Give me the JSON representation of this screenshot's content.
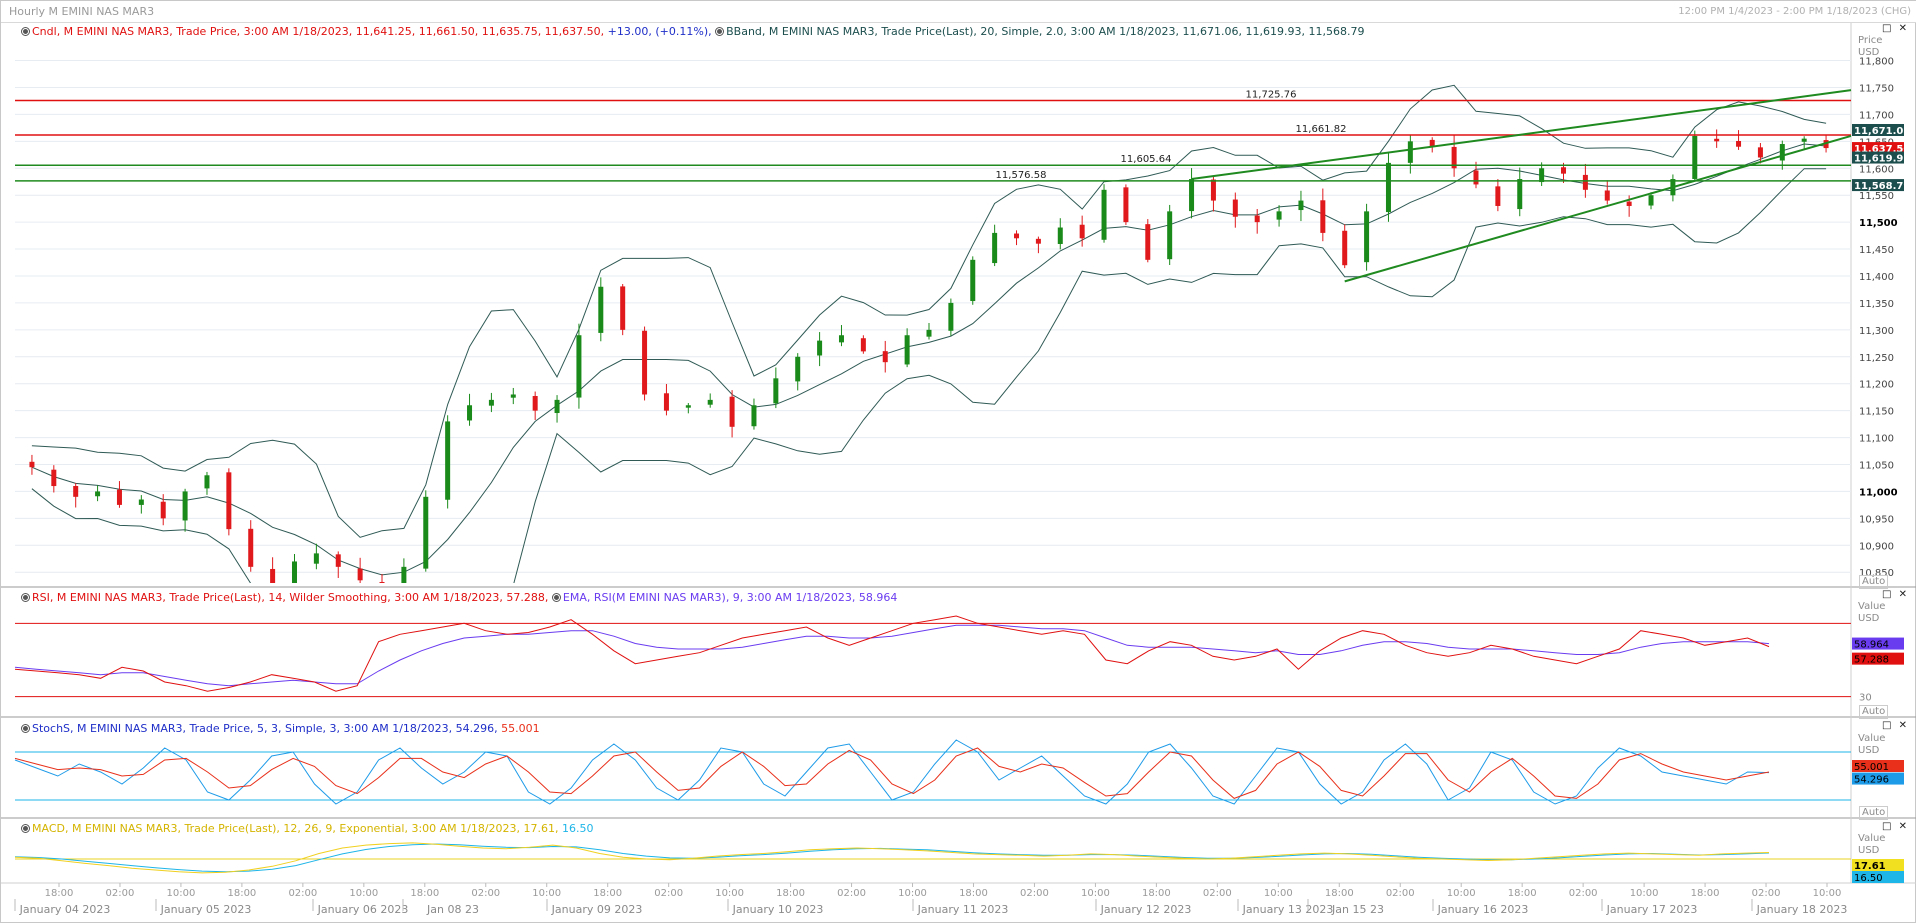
{
  "window": {
    "title": "Hourly M EMINI NAS MAR3",
    "range_text": "12:00 PM 1/4/2023 - 2:00 PM 1/18/2023 (CHG)",
    "controls": "□ ✕"
  },
  "legends": {
    "price_cndl": {
      "label": "Cndl, M EMINI NAS MAR3, Trade Price,  3:00 AM 1/18/2023, 11,641.25, 11,661.50, 11,635.75, 11,637.50,",
      "change": " +13.00,  (+0.11%),"
    },
    "price_bband": "BBand, M EMINI NAS MAR3, Trade Price(Last),  20, Simple, 2.0,  3:00 AM 1/18/2023, 11,671.06, 11,619.93, 11,568.79",
    "rsi": "RSI, M EMINI NAS MAR3, Trade Price(Last),  14, Wilder Smoothing,  3:00 AM 1/18/2023, 57.288,",
    "rsi_ema": "EMA, RSI(M EMINI NAS MAR3),  9,  3:00 AM 1/18/2023, 58.964",
    "stoch": "StochS, M EMINI NAS MAR3, Trade Price,  5, 3, Simple, 3,  3:00 AM 1/18/2023, 54.296,",
    "stoch_d": " 55.001",
    "macd": "MACD, M EMINI NAS MAR3, Trade Price(Last),  12, 26, 9, Exponential,  3:00 AM 1/18/2023, 17.61,",
    "macd_signal": " 16.50"
  },
  "axes": {
    "price_title_1": "Price",
    "price_title_2": "USD",
    "value_title": "Value",
    "value_unit": "USD",
    "auto_label": "Auto"
  },
  "colors": {
    "up": "#1a8a1a",
    "down": "#e0191c",
    "bband": "#2f5a55",
    "hline_red": "#e01010",
    "hline_green": "#1f8a1f",
    "trend": "#1f8a1f",
    "rsi": "#e01010",
    "rsi_ema": "#6a3cf0",
    "stoch_k": "#1e9be8",
    "stoch_d": "#e8301a",
    "macd": "#f0d020",
    "macd_signal": "#1eb5e8",
    "grid": "#e6ecf2",
    "legend_blue": "#1f2f9a"
  },
  "chart_data": [
    {
      "type": "candlestick",
      "title": "Hourly M EMINI NAS MAR3",
      "ylabel": "Price USD",
      "ylim": [
        10830,
        11840
      ],
      "yticks": [
        10850,
        10900,
        10950,
        11000,
        11050,
        11100,
        11150,
        11200,
        11250,
        11300,
        11350,
        11400,
        11450,
        11500,
        11550,
        11600,
        11650,
        11700,
        11750,
        11800
      ],
      "bold_ticks": [
        11000,
        11500
      ],
      "x_time_labels": [
        "18:00",
        "02:00",
        "10:00",
        "18:00",
        "02:00",
        "10:00",
        "18:00",
        "02:00",
        "10:00",
        "18:00",
        "02:00",
        "10:00",
        "18:00",
        "02:00",
        "10:00",
        "18:00",
        "02:00",
        "10:00",
        "18:00",
        "02:00",
        "10:00",
        "18:00",
        "02:00",
        "10:00",
        "18:00",
        "02:00",
        "10:00",
        "18:00",
        "02:00",
        "10:00"
      ],
      "x_date_labels": [
        "January 04 2023",
        "January 05 2023",
        "January 06 2023",
        "Jan 08 23",
        "January 09 2023",
        "January 10 2023",
        "January 11 2023",
        "January 12 2023",
        "January 13 2023",
        "Jan 15 23",
        "January 16 2023",
        "January 17 2023",
        "January 18 2023"
      ],
      "close_path": [
        11045,
        11010,
        10990,
        11000,
        10975,
        10985,
        10950,
        11000,
        11030,
        10930,
        10860,
        10830,
        10870,
        10885,
        10860,
        10835,
        10790,
        10860,
        10990,
        11130,
        11160,
        11170,
        11180,
        11150,
        11170,
        11290,
        11380,
        11300,
        11180,
        11150,
        11160,
        11170,
        11120,
        11160,
        11210,
        11250,
        11280,
        11290,
        11260,
        11240,
        11290,
        11300,
        11350,
        11430,
        11480,
        11470,
        11460,
        11490,
        11470,
        11560,
        11500,
        11430,
        11520,
        11580,
        11540,
        11510,
        11500,
        11520,
        11540,
        11480,
        11420,
        11520,
        11610,
        11650,
        11640,
        11600,
        11570,
        11530,
        11580,
        11600,
        11590,
        11560,
        11540,
        11530,
        11550,
        11580,
        11660,
        11650,
        11640,
        11620,
        11645,
        11655,
        11637.5
      ],
      "current_price": 11637.5,
      "horizontal_lines": [
        {
          "value": 11725.76,
          "label": "11,725.76",
          "color": "red"
        },
        {
          "value": 11661.82,
          "label": "11,661.82",
          "color": "red"
        },
        {
          "value": 11605.64,
          "label": "11,605.64",
          "color": "green"
        },
        {
          "value": 11576.58,
          "label": "11,576.58",
          "color": "green"
        }
      ],
      "price_tags": [
        {
          "value": 11671.06,
          "label": "11,671.06",
          "bg": "#1d4e4e"
        },
        {
          "value": 11637.5,
          "label": "11,637.50",
          "bg": "#e01010"
        },
        {
          "value": 11619.93,
          "label": "11,619.93",
          "bg": "#1d4e4e"
        },
        {
          "value": 11568.79,
          "label": "11,568.79",
          "bg": "#1d4e4e"
        }
      ],
      "bollinger": {
        "period": 20,
        "stddev": 2.0,
        "upper_last": 11671.06,
        "middle_last": 11619.93,
        "lower_last": 11568.79
      }
    },
    {
      "type": "line",
      "title": "RSI",
      "ylim": [
        20,
        80
      ],
      "reference_lines": [
        70,
        30
      ],
      "tick_labels": [
        "30"
      ],
      "series": [
        {
          "name": "RSI",
          "values": [
            45,
            44,
            43,
            42,
            40,
            46,
            44,
            38,
            36,
            33,
            35,
            38,
            42,
            40,
            38,
            33,
            36,
            60,
            64,
            66,
            68,
            70,
            66,
            64,
            65,
            68,
            72,
            64,
            55,
            48,
            50,
            52,
            54,
            58,
            62,
            64,
            66,
            68,
            62,
            58,
            62,
            66,
            70,
            72,
            74,
            70,
            68,
            66,
            64,
            66,
            64,
            50,
            48,
            55,
            60,
            58,
            52,
            50,
            52,
            56,
            45,
            55,
            62,
            66,
            64,
            58,
            54,
            52,
            54,
            58,
            56,
            52,
            50,
            48,
            52,
            56,
            66,
            64,
            62,
            58,
            60,
            62,
            57.288
          ]
        },
        {
          "name": "EMA",
          "values": [
            46,
            45,
            44,
            43,
            42,
            43,
            43,
            41,
            39,
            37,
            36,
            37,
            38,
            39,
            38,
            37,
            37,
            44,
            50,
            55,
            59,
            62,
            63,
            64,
            64,
            65,
            66,
            66,
            63,
            59,
            57,
            56,
            56,
            56,
            57,
            59,
            61,
            63,
            63,
            62,
            62,
            63,
            65,
            67,
            69,
            69,
            69,
            68,
            67,
            67,
            66,
            62,
            58,
            57,
            57,
            57,
            56,
            55,
            54,
            55,
            53,
            53,
            55,
            58,
            60,
            60,
            59,
            57,
            56,
            56,
            56,
            55,
            54,
            53,
            53,
            54,
            57,
            59,
            60,
            60,
            60,
            60,
            58.964
          ]
        }
      ]
    },
    {
      "type": "line",
      "title": "StochS",
      "ylim": [
        0,
        100
      ],
      "reference_lines": [
        80,
        20
      ],
      "series": [
        {
          "name": "%K",
          "values": [
            70,
            60,
            50,
            65,
            55,
            40,
            60,
            85,
            70,
            30,
            20,
            45,
            75,
            80,
            40,
            15,
            30,
            70,
            85,
            60,
            40,
            55,
            80,
            75,
            30,
            15,
            35,
            70,
            90,
            70,
            35,
            20,
            45,
            85,
            80,
            40,
            25,
            55,
            85,
            90,
            55,
            20,
            30,
            65,
            95,
            80,
            45,
            60,
            75,
            50,
            25,
            15,
            40,
            80,
            90,
            60,
            25,
            15,
            50,
            85,
            80,
            40,
            15,
            30,
            70,
            90,
            65,
            20,
            35,
            80,
            70,
            30,
            15,
            25,
            60,
            85,
            75,
            55,
            50,
            45,
            40,
            55,
            54.296
          ]
        },
        {
          "name": "%D",
          "values": [
            72,
            65,
            58,
            60,
            58,
            50,
            52,
            70,
            72,
            55,
            35,
            38,
            58,
            72,
            62,
            38,
            28,
            48,
            72,
            72,
            55,
            48,
            65,
            75,
            55,
            30,
            28,
            50,
            75,
            80,
            55,
            32,
            35,
            62,
            80,
            62,
            38,
            40,
            65,
            82,
            70,
            40,
            28,
            45,
            75,
            85,
            62,
            55,
            65,
            60,
            42,
            25,
            28,
            55,
            80,
            75,
            45,
            22,
            32,
            65,
            80,
            62,
            32,
            25,
            50,
            78,
            78,
            45,
            30,
            55,
            72,
            50,
            25,
            22,
            40,
            70,
            78,
            65,
            55,
            50,
            45,
            50,
            55.001
          ]
        }
      ]
    },
    {
      "type": "line",
      "title": "MACD",
      "ylim": [
        -60,
        60
      ],
      "reference_lines": [
        0
      ],
      "series": [
        {
          "name": "MACD",
          "values": [
            5,
            2,
            -5,
            -12,
            -18,
            -25,
            -30,
            -35,
            -38,
            -36,
            -30,
            -20,
            -5,
            15,
            30,
            38,
            42,
            44,
            40,
            35,
            30,
            28,
            32,
            38,
            30,
            15,
            5,
            0,
            -2,
            2,
            8,
            12,
            15,
            20,
            25,
            28,
            30,
            28,
            25,
            22,
            18,
            14,
            12,
            10,
            8,
            10,
            14,
            12,
            8,
            5,
            2,
            0,
            2,
            6,
            10,
            14,
            16,
            14,
            10,
            6,
            2,
            0,
            -2,
            -4,
            -2,
            2,
            6,
            10,
            14,
            16,
            14,
            12,
            10,
            14,
            16,
            17.61
          ]
        },
        {
          "name": "Signal",
          "values": [
            6,
            4,
            0,
            -6,
            -12,
            -18,
            -24,
            -29,
            -33,
            -35,
            -33,
            -28,
            -18,
            -2,
            14,
            26,
            34,
            39,
            41,
            39,
            35,
            32,
            31,
            34,
            33,
            25,
            15,
            8,
            3,
            2,
            5,
            9,
            12,
            16,
            21,
            25,
            28,
            29,
            27,
            25,
            21,
            17,
            14,
            12,
            10,
            10,
            12,
            12,
            10,
            7,
            4,
            2,
            2,
            4,
            7,
            11,
            14,
            15,
            13,
            9,
            5,
            2,
            0,
            -2,
            -2,
            0,
            3,
            7,
            11,
            14,
            15,
            13,
            11,
            12,
            14,
            16.5
          ]
        }
      ]
    }
  ]
}
